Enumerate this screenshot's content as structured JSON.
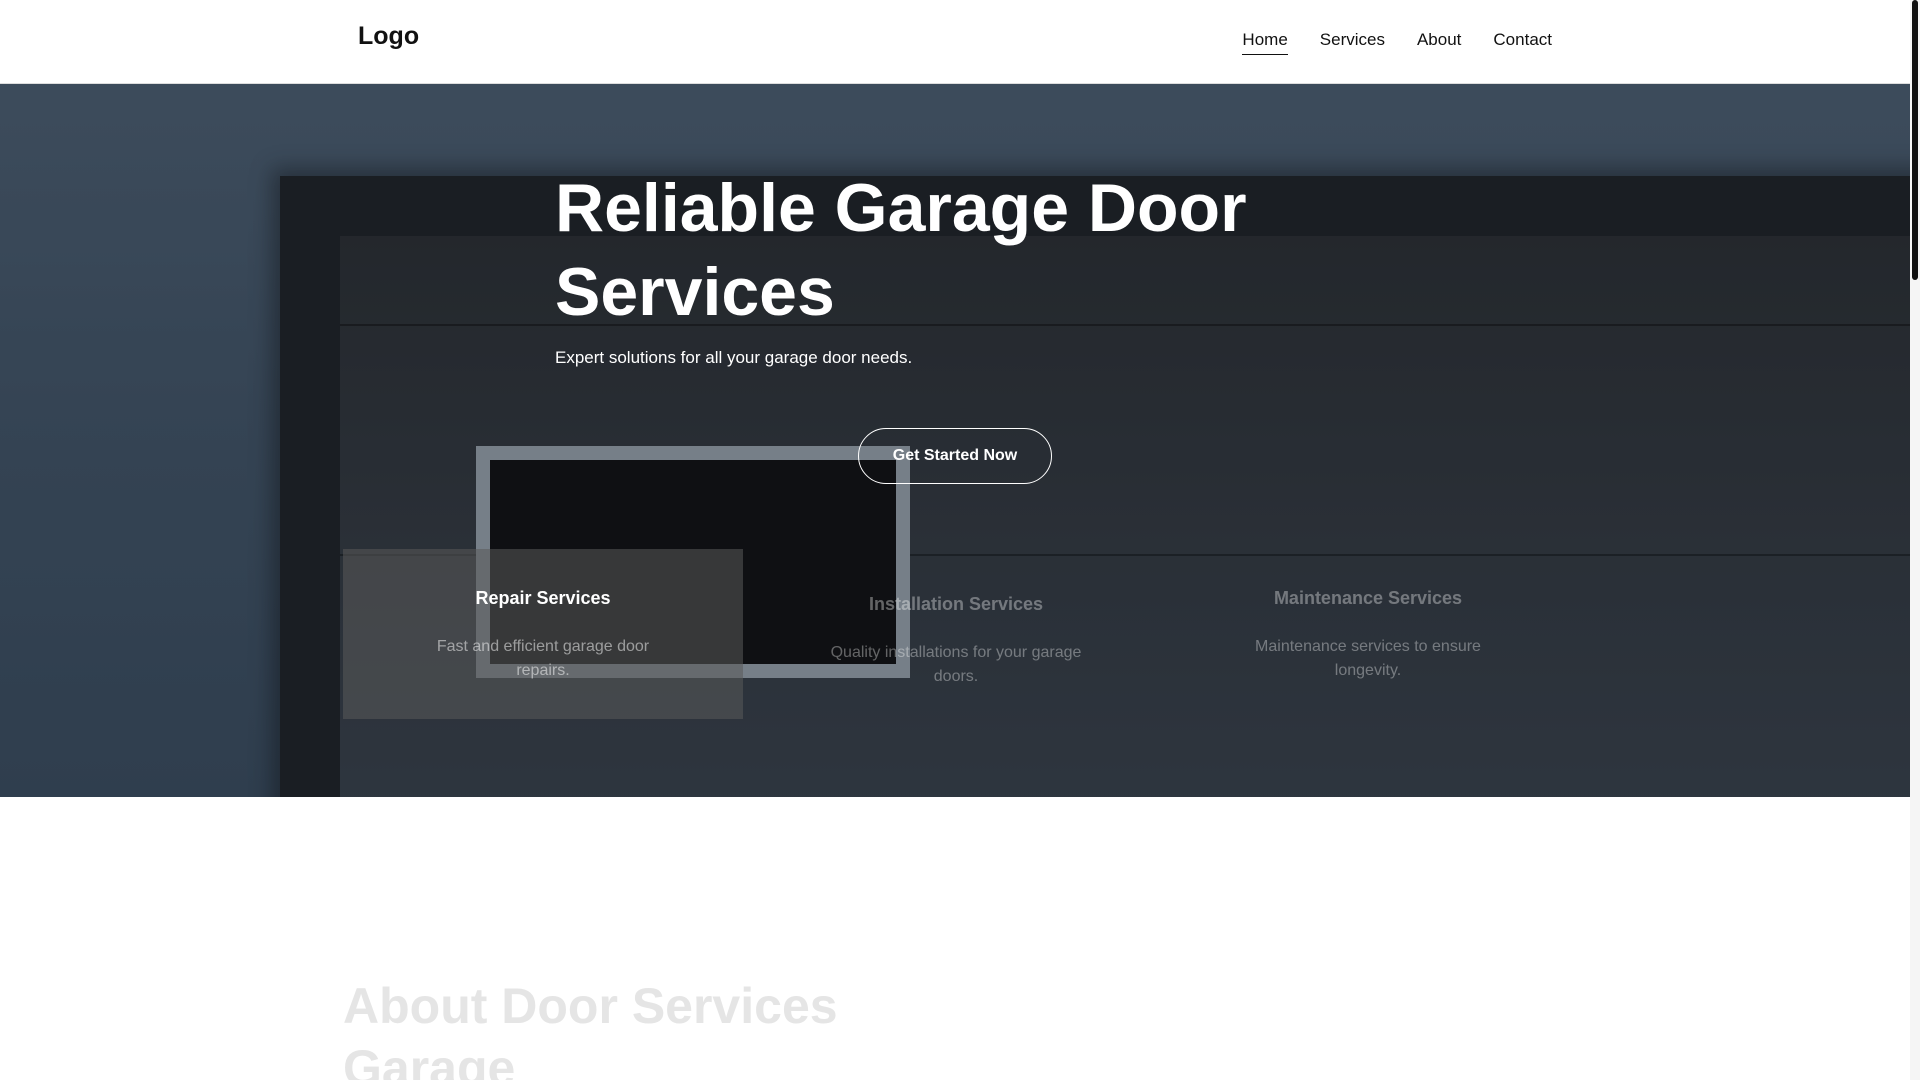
{
  "header": {
    "logo": "Logo",
    "nav": [
      {
        "label": "Home",
        "active": true
      },
      {
        "label": "Services",
        "active": false
      },
      {
        "label": "About",
        "active": false
      },
      {
        "label": "Contact",
        "active": false
      }
    ]
  },
  "hero": {
    "title": "Reliable Garage Door Services",
    "subtitle": "Expert solutions for all your garage door needs.",
    "cta_label": "Get Started Now"
  },
  "services": [
    {
      "title": "Repair Services",
      "text": "Fast and efficient garage door repairs."
    },
    {
      "title": "Installation Services",
      "text": "Quality installations for your garage doors."
    },
    {
      "title": "Maintenance Services",
      "text": "Maintenance services to ensure longevity."
    }
  ],
  "about": {
    "title": "About Door Services Garage"
  },
  "colors": {
    "hero_bg": "#43576b",
    "text_on_hero": "#ffffff",
    "about_title": "#e5e5e5"
  }
}
